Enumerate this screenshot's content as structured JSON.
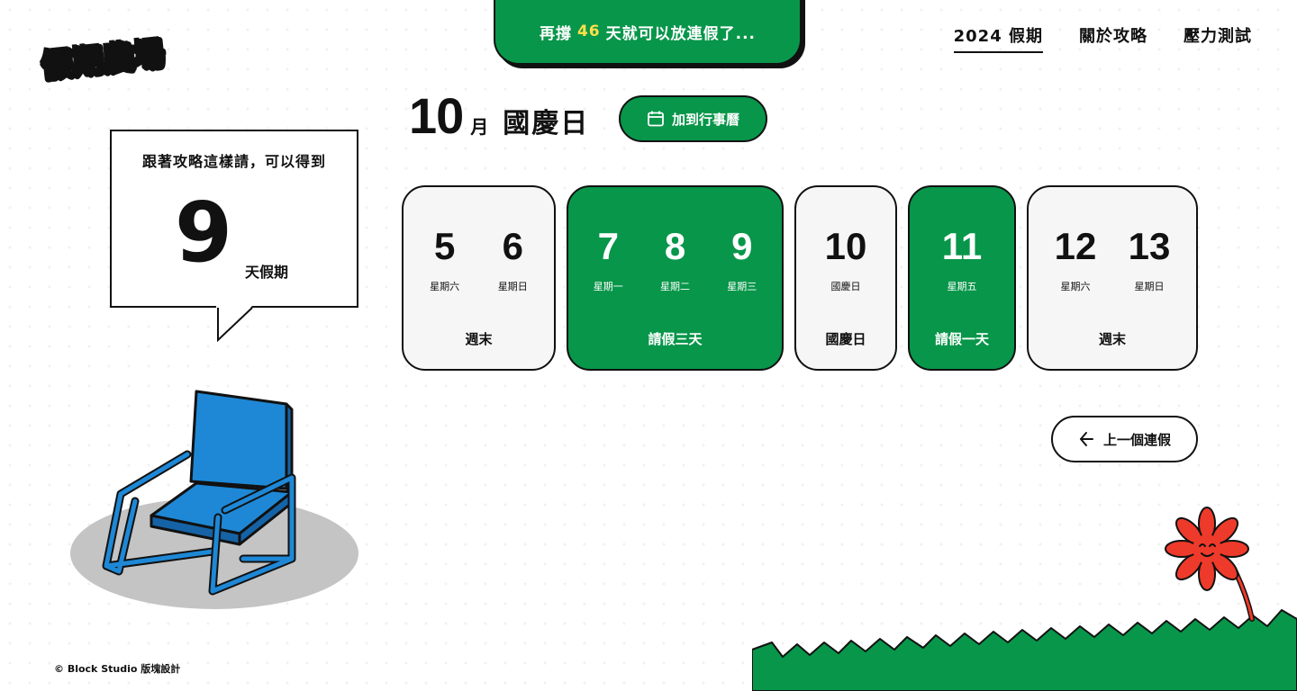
{
  "brand": {
    "logo_text": "假期農場"
  },
  "countdown": {
    "prefix": "再撐",
    "days": "46",
    "suffix": "天就可以放連假了..."
  },
  "nav": [
    {
      "label": "2024 假期",
      "active": true
    },
    {
      "label": "關於攻略",
      "active": false
    },
    {
      "label": "壓力測試",
      "active": false
    }
  ],
  "summary": {
    "lead": "跟著攻略這樣請，可以得到",
    "total_days": "9",
    "unit": "天假期"
  },
  "holiday": {
    "month": "10",
    "month_unit": "月",
    "name": "國慶日"
  },
  "add_calendar": {
    "label": "加到行事曆",
    "icon": "calendar-icon"
  },
  "cards": [
    {
      "type": "weekend",
      "label": "週末",
      "days": [
        {
          "num": "5",
          "weekday": "星期六"
        },
        {
          "num": "6",
          "weekday": "星期日"
        }
      ]
    },
    {
      "type": "leave",
      "label": "請假三天",
      "days": [
        {
          "num": "7",
          "weekday": "星期一"
        },
        {
          "num": "8",
          "weekday": "星期二"
        },
        {
          "num": "9",
          "weekday": "星期三"
        }
      ]
    },
    {
      "type": "holiday",
      "label": "國慶日",
      "days": [
        {
          "num": "10",
          "weekday": "國慶日"
        }
      ]
    },
    {
      "type": "leave",
      "label": "請假一天",
      "days": [
        {
          "num": "11",
          "weekday": "星期五"
        }
      ]
    },
    {
      "type": "weekend",
      "label": "週末",
      "days": [
        {
          "num": "12",
          "weekday": "星期六"
        },
        {
          "num": "13",
          "weekday": "星期日"
        }
      ]
    }
  ],
  "prev_button": {
    "label": "上一個連假",
    "icon": "arrow-left-icon"
  },
  "footer": {
    "text": "© Block Studio 版塊設計"
  },
  "colors": {
    "green": "#08964a",
    "accent_yellow": "#ffe14a",
    "chair_blue": "#1e88d6",
    "flower_red": "#ee3a2a"
  }
}
